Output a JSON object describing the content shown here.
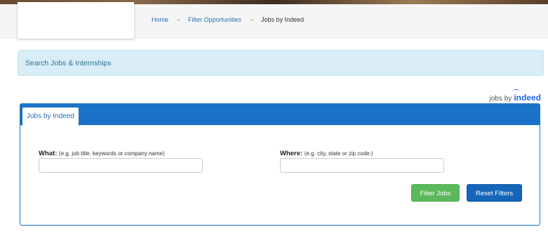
{
  "breadcrumb": {
    "items": [
      {
        "label": "Home"
      },
      {
        "label": "Filter Opportunities"
      },
      {
        "label": "Jobs by Indeed"
      }
    ],
    "separator": "→"
  },
  "banner": {
    "title": "Search Jobs & Internships"
  },
  "attribution": {
    "prefix": "jobs by",
    "brand": "indeed"
  },
  "panel": {
    "tab_label": "Jobs by Indeed",
    "what": {
      "label": "What:",
      "hint": "(e.g. job title, keywords or company name)",
      "value": ""
    },
    "where": {
      "label": "Where:",
      "hint": "(e.g. city, state or zip code:)",
      "value": ""
    },
    "filter_button": "Filter Jobs",
    "reset_button": "Reset Filters"
  },
  "colors": {
    "panel_blue": "#1a73c8",
    "banner_bg": "#d9edf7",
    "filter_green": "#5cb85c",
    "reset_blue": "#1565b8",
    "indeed_blue": "#2164f3"
  }
}
